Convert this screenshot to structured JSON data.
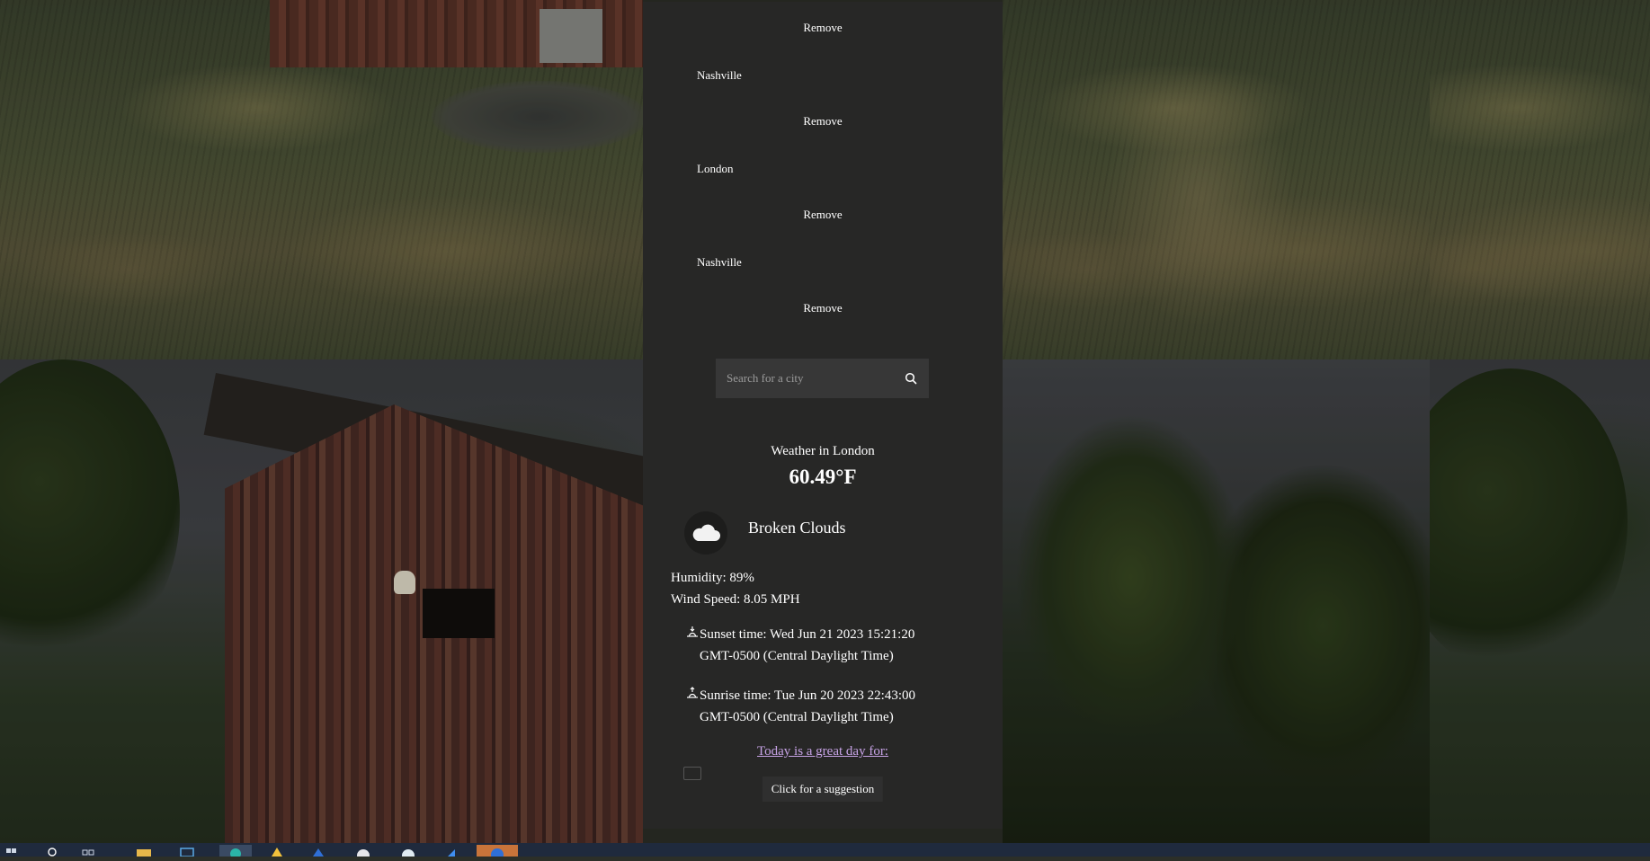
{
  "recent_searches": {
    "remove_label": "Remove",
    "items": [
      {
        "city": "Nashville"
      },
      {
        "city": "London"
      },
      {
        "city": "Nashville"
      }
    ]
  },
  "search": {
    "placeholder": "Search for a city",
    "icon": "search-icon"
  },
  "weather": {
    "title": "Weather in London",
    "temperature": "60.49°F",
    "icon": "cloud-icon",
    "description": "Broken Clouds",
    "humidity": "Humidity: 89%",
    "wind": "Wind Speed: 8.05 MPH",
    "sunset_line1": "Sunset time: Wed Jun 21 2023 15:21:20",
    "sunset_line2": "GMT-0500 (Central Daylight Time)",
    "sunrise_line1": "Sunrise time: Tue Jun 20 2023 22:43:00",
    "sunrise_line2": "GMT-0500 (Central Daylight Time)"
  },
  "suggestion": {
    "link_text": "Today is a great day for:",
    "button_label": "Click for a suggestion"
  },
  "colors": {
    "card_bg": "#282828",
    "link": "#c7a3e6",
    "taskbar": "#1f2a3d"
  }
}
